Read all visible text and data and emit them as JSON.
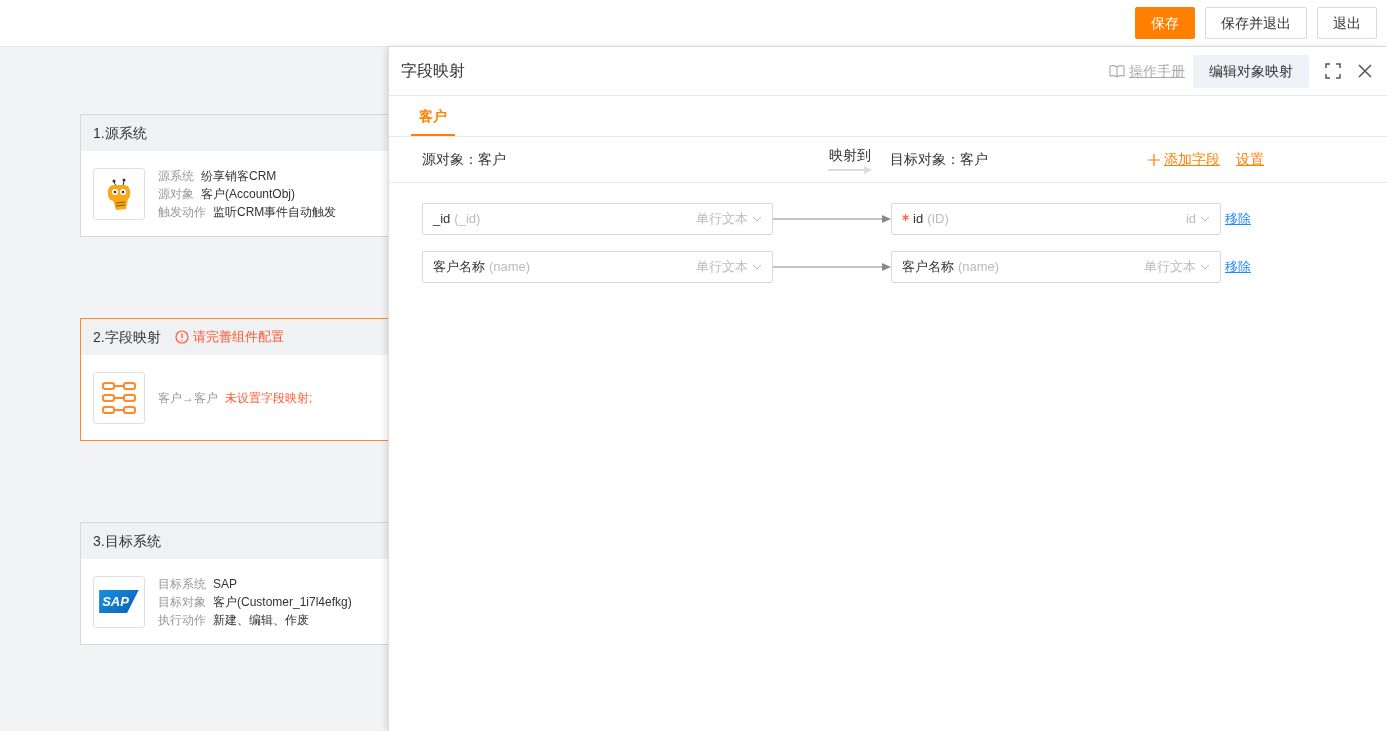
{
  "toolbar": {
    "buttons": [
      {
        "label": "保存",
        "kind": "primary"
      },
      {
        "label": "保存并退出",
        "kind": "default"
      },
      {
        "label": "退出",
        "kind": "default"
      }
    ]
  },
  "flow": {
    "nodes": [
      {
        "kind": "source",
        "title": "1.源系统",
        "selected": false,
        "details": [
          {
            "label": "源系统",
            "value": "纷享销客CRM"
          },
          {
            "label": "源对象",
            "value": "客户(AccountObj)"
          },
          {
            "label": "触发动作",
            "value": "监听CRM事件自动触发"
          }
        ]
      },
      {
        "kind": "mapping",
        "title": "2.字段映射",
        "selected": true,
        "warning": "请完善组件配置",
        "summary": "客户→客户",
        "summary_warning": "未设置字段映射",
        "summary_tail": ";"
      },
      {
        "kind": "target",
        "title": "3.目标系统",
        "selected": false,
        "logo_text": "SAP",
        "details": [
          {
            "label": "目标系统",
            "value": "SAP"
          },
          {
            "label": "目标对象",
            "value": "客户(Customer_1i7l4efkg)"
          },
          {
            "label": "执行动作",
            "value": "新建、编辑、作废"
          }
        ]
      }
    ]
  },
  "panel": {
    "title": "字段映射",
    "manual": "操作手册",
    "edit_button": "编辑对象映射",
    "tabs": [
      {
        "label": "客户",
        "selected": true
      }
    ],
    "source_object": "源对象：客户",
    "maps_to": "映射到",
    "target_object": "目标对象：客户",
    "add_field": "添加字段",
    "settings": "设置",
    "rows": [
      {
        "source": {
          "name": "_id",
          "api": "(_id)",
          "type": "单行文本"
        },
        "target": {
          "required": true,
          "name": "id",
          "api": "(ID)",
          "type": "id"
        },
        "remove": "移除"
      },
      {
        "source": {
          "name": "客户名称",
          "api": "(name)",
          "type": "单行文本"
        },
        "target": {
          "required": false,
          "name": "客户名称",
          "api": "(name)",
          "type": "单行文本"
        },
        "remove": "移除"
      }
    ]
  }
}
